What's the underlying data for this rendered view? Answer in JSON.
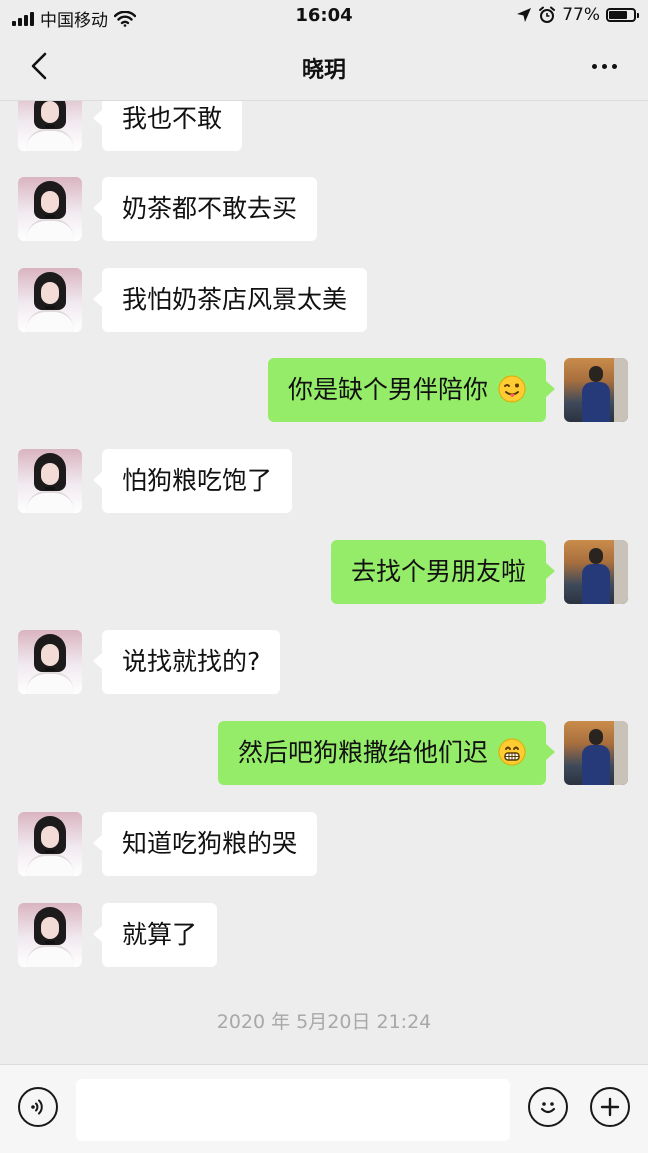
{
  "status_bar": {
    "carrier": "中国移动",
    "time": "16:04",
    "battery_percent": "77%",
    "battery_level": 0.77,
    "icons": [
      "signal-icon",
      "wifi-icon",
      "location-icon",
      "alarm-icon",
      "battery-icon"
    ]
  },
  "nav": {
    "title": "晓玥",
    "back_icon": "chevron-left-icon",
    "more_icon": "more-icon"
  },
  "messages": [
    {
      "side": "left",
      "text": "我也不敢"
    },
    {
      "side": "left",
      "text": "奶茶都不敢去买"
    },
    {
      "side": "left",
      "text": "我怕奶茶店风景太美"
    },
    {
      "side": "right",
      "text": "你是缺个男伴陪你",
      "emoji": "winking-tongue-emoji"
    },
    {
      "side": "left",
      "text": "怕狗粮吃饱了"
    },
    {
      "side": "right",
      "text": "去找个男朋友啦"
    },
    {
      "side": "left",
      "text": "说找就找的?"
    },
    {
      "side": "right",
      "text": "然后吧狗粮撒给他们迟",
      "emoji": "grinning-emoji"
    },
    {
      "side": "left",
      "text": "知道吃狗粮的哭"
    },
    {
      "side": "left",
      "text": "就算了"
    }
  ],
  "timestamp": "2020 年 5月20日 21:24",
  "input_bar": {
    "text_value": "",
    "icons": [
      "voice-icon",
      "emoji-icon",
      "plus-icon"
    ]
  },
  "colors": {
    "background": "#ededed",
    "bubble_self": "#95ec69",
    "bubble_other": "#ffffff",
    "timestamp": "#a8a8a8"
  }
}
